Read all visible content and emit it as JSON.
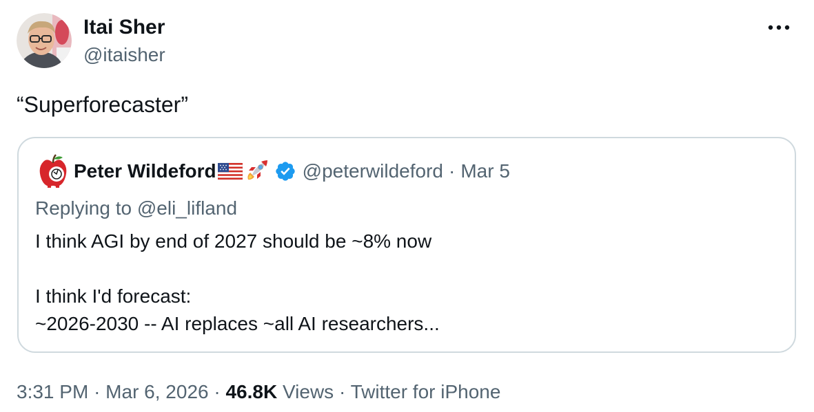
{
  "author": {
    "name": "Itai Sher",
    "handle": "@itaisher"
  },
  "menu": {
    "icon": "more-horizontal-icon"
  },
  "tweet": {
    "text": "“Superforecaster”"
  },
  "quoted": {
    "avatar_icon": "apple-avatar-icon",
    "name": "Peter Wildeford",
    "name_emojis": [
      "us-flag-icon",
      "rocket-icon"
    ],
    "verified_icon": "verified-badge-icon",
    "handle": "@peterwildeford",
    "separator": "·",
    "date": "Mar 5",
    "replying_to": "Replying to @eli_lifland",
    "lines": [
      "I think AGI by end of 2027 should be ~8% now",
      "I think I'd forecast:",
      "~2026-2030 -- AI replaces ~all AI researchers..."
    ]
  },
  "meta": {
    "time": "3:31 PM",
    "sep1": "·",
    "date": "Mar 6, 2026",
    "sep2": "·",
    "views_count": "46.8K",
    "views_label": "Views",
    "sep3": "·",
    "source": "Twitter for iPhone"
  },
  "colors": {
    "text_primary": "#0f1419",
    "text_secondary": "#536471",
    "border": "#cfd9de",
    "verified_blue": "#1d9bf0"
  }
}
